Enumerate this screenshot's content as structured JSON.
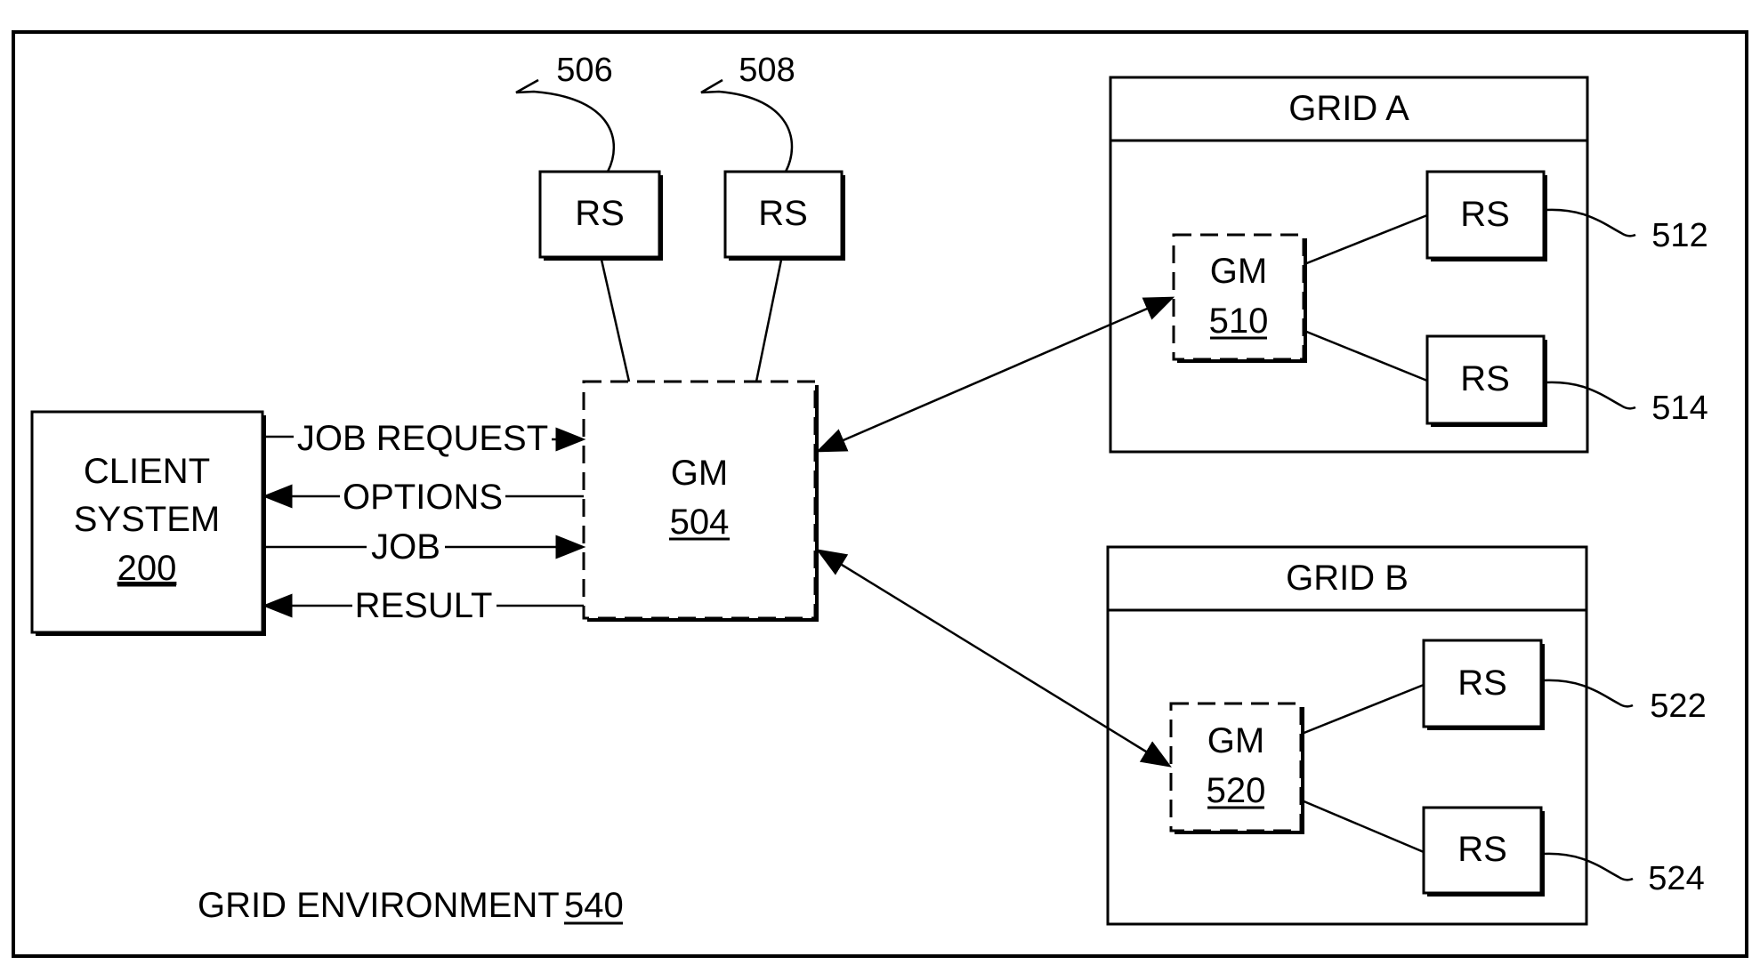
{
  "diagram": {
    "environment": {
      "label": "GRID ENVIRONMENT",
      "ref": "540"
    },
    "client": {
      "line1": "CLIENT",
      "line2": "SYSTEM",
      "ref": "200"
    },
    "gm_main": {
      "label": "GM",
      "ref": "504"
    },
    "rs_top": [
      {
        "label": "RS",
        "ref": "506"
      },
      {
        "label": "RS",
        "ref": "508"
      }
    ],
    "messages": [
      {
        "label": "JOB REQUEST",
        "direction": "to-gm"
      },
      {
        "label": "OPTIONS",
        "direction": "to-client"
      },
      {
        "label": "JOB",
        "direction": "to-gm"
      },
      {
        "label": "RESULT",
        "direction": "to-client"
      }
    ],
    "grids": [
      {
        "title": "GRID A",
        "gm": {
          "label": "GM",
          "ref": "510"
        },
        "rs": [
          {
            "label": "RS",
            "ref": "512"
          },
          {
            "label": "RS",
            "ref": "514"
          }
        ]
      },
      {
        "title": "GRID B",
        "gm": {
          "label": "GM",
          "ref": "520"
        },
        "rs": [
          {
            "label": "RS",
            "ref": "522"
          },
          {
            "label": "RS",
            "ref": "524"
          }
        ]
      }
    ]
  }
}
